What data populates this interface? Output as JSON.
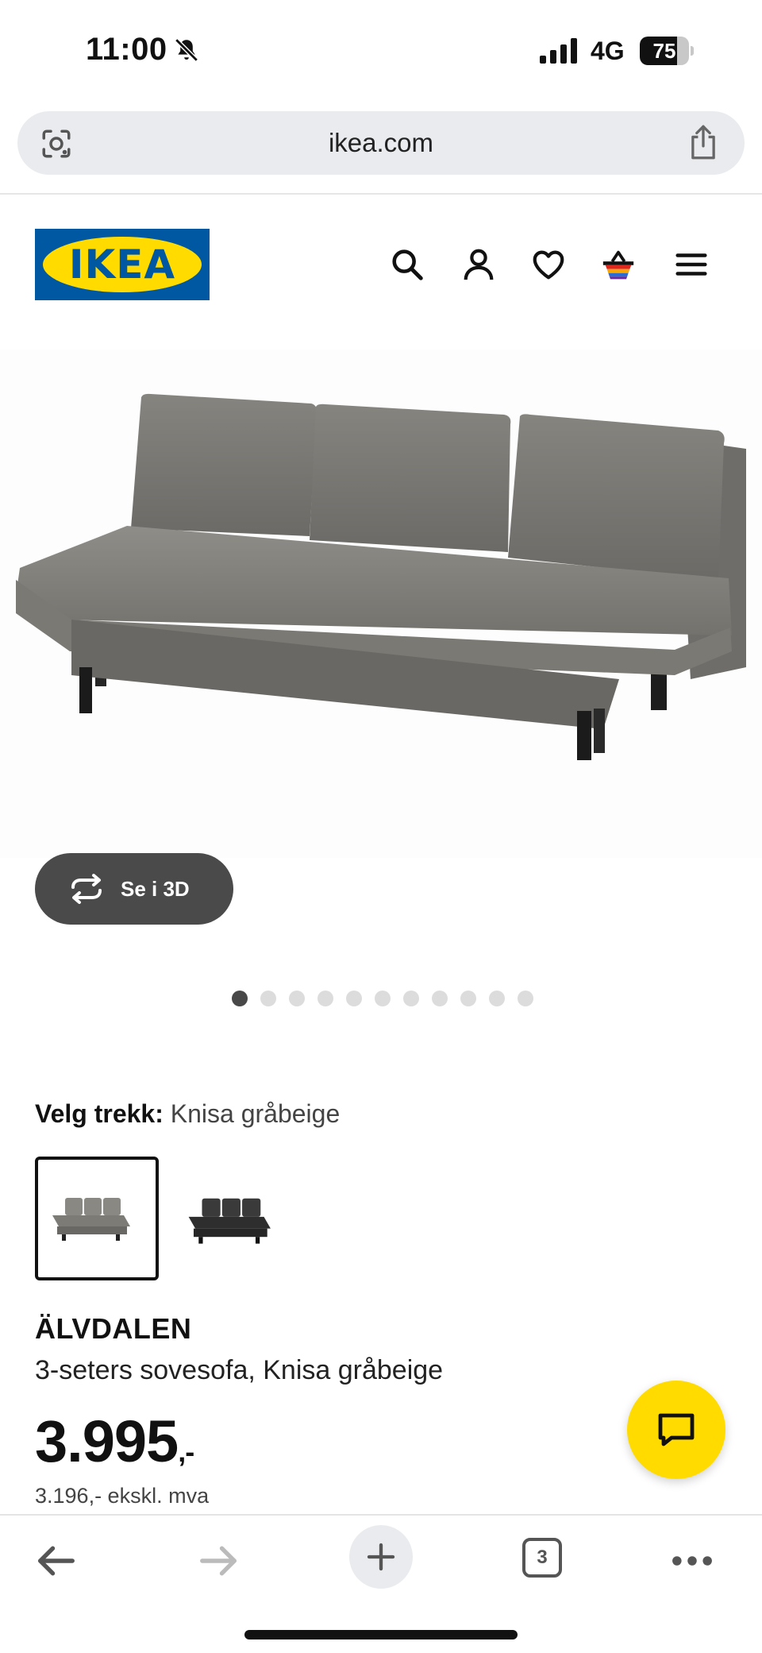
{
  "status_bar": {
    "time": "11:00",
    "network": "4G",
    "battery": "75",
    "battery_level": 0.75
  },
  "browser": {
    "url": "ikea.com",
    "tab_count": "3"
  },
  "header": {
    "logo_text": "IKEA",
    "brand_colors": {
      "blue": "#0058a3",
      "yellow": "#ffdb00"
    }
  },
  "gallery": {
    "view_3d_label": "Se i 3D",
    "image_count": 11,
    "active_index": 0
  },
  "variant": {
    "label": "Velg trekk:",
    "selected": "Knisa gråbeige",
    "options": [
      {
        "color": "#8a8883",
        "selected": true
      },
      {
        "color": "#3a3a3a",
        "selected": false
      }
    ]
  },
  "product": {
    "name": "ÄLVDALEN",
    "description": "3-seters sovesofa, Knisa gråbeige",
    "price": "3.995",
    "price_suffix": ",-",
    "price_ex_vat": "3.196,- ekskl. mva"
  },
  "icons": [
    "bell-slash-icon",
    "signal-icon",
    "battery-icon",
    "lens-icon",
    "share-icon",
    "search-icon",
    "user-icon",
    "heart-icon",
    "cart-icon",
    "menu-icon",
    "rotate-3d-icon",
    "chat-icon",
    "back-icon",
    "forward-icon",
    "plus-icon",
    "tabs-icon",
    "more-icon"
  ]
}
